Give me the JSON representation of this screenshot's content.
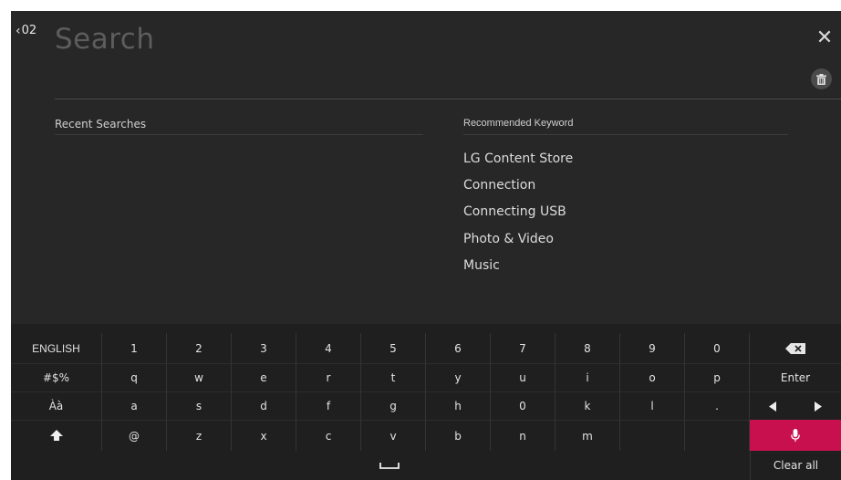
{
  "header": {
    "back_label": "02",
    "search_placeholder": "Search"
  },
  "recent": {
    "title": "Recent Searches"
  },
  "recommended": {
    "title": "Recommended Keyword",
    "items": [
      "LG Content Store",
      "Connection",
      "Connecting USB",
      "Photo & Video",
      "Music"
    ]
  },
  "keyboard": {
    "row1": [
      "ENGLISH",
      "1",
      "2",
      "3",
      "4",
      "5",
      "6",
      "7",
      "8",
      "9",
      "0"
    ],
    "row2": [
      "#$%",
      "q",
      "w",
      "e",
      "r",
      "t",
      "y",
      "u",
      "i",
      "o",
      "p"
    ],
    "row2_last": "Enter",
    "row3": [
      "Àà",
      "a",
      "s",
      "d",
      "f",
      "g",
      "h",
      "0",
      "k",
      "l",
      "."
    ],
    "row4": [
      "@",
      "z",
      "x",
      "c",
      "v",
      "b",
      "n",
      "m",
      ""
    ],
    "clear_all": "Clear all"
  },
  "colors": {
    "background": "#272727",
    "keyboard_bg": "#1f1f1f",
    "accent": "#c8104f"
  },
  "icons": [
    "back-chevron-icon",
    "close-icon",
    "trash-icon",
    "backspace-icon",
    "arrow-left-icon",
    "arrow-right-icon",
    "shift-icon",
    "microphone-icon",
    "space-icon"
  ]
}
